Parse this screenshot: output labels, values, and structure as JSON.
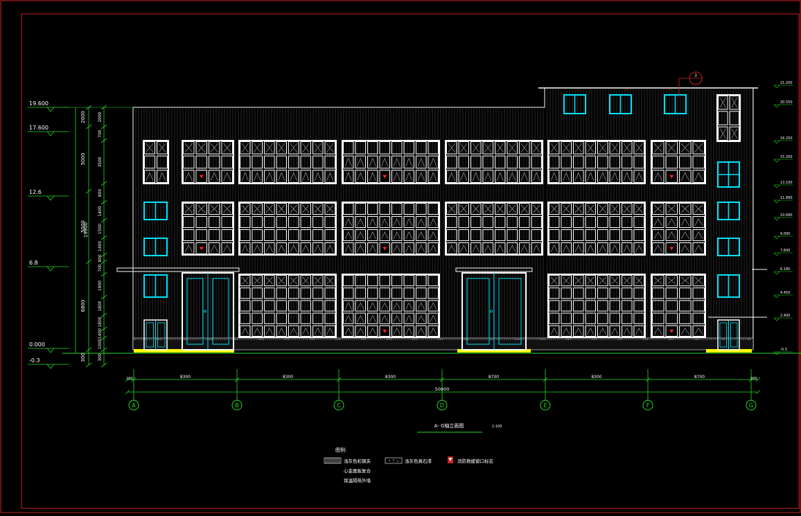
{
  "drawing": {
    "title": "A- G轴立面图",
    "scale": "1:100",
    "colors": {
      "background": "#000000",
      "frame": "#cc2222",
      "wall": "#ffffff",
      "window_white": "#ffffff",
      "window_cyan": "#00e5ff",
      "dimension": "#22dd22",
      "ground": "#ffff00",
      "marker": "#ff2222"
    },
    "left_levels": [
      "19.600",
      "17.600",
      "12.6",
      "6.8",
      "0.000",
      "-0.3"
    ],
    "right_levels": [
      "21.200",
      "20.550",
      "16.250",
      "15.200",
      "13.100",
      "11.890",
      "10.690",
      "9.000",
      "7.600",
      "6.180",
      "4.450",
      "2.400",
      "-0.3"
    ],
    "vertical_total": "19900",
    "vertical_dims_outer": [
      "2000",
      "5000",
      "5000",
      "6800",
      "300"
    ],
    "vertical_dims_inner": [
      "2000",
      "700",
      "3500",
      "800",
      "1400",
      "1500",
      "1400",
      "800",
      "700",
      "1900",
      "1800",
      "1800",
      "1400",
      "1000",
      "300"
    ],
    "axis_labels": [
      "A",
      "B",
      "C",
      "D",
      "E",
      "F",
      "G"
    ],
    "bay_dims": [
      "8300",
      "8300",
      "8300",
      "8700",
      "8300",
      "8700"
    ],
    "end_dims": [
      "100",
      "100"
    ],
    "total_dim": "50800",
    "callout": "3",
    "legend": {
      "heading": "图例:",
      "items": [
        {
          "symbol": "wall-panel",
          "text": "浅灰色彩钢夹"
        },
        {
          "symbol": "stone",
          "text": "浅灰色真石漆"
        },
        {
          "symbol": "escape-marker",
          "text": "消防救援窗口标志"
        }
      ],
      "extra_lines": [
        "心金属板复合",
        "保温隔热外墙"
      ]
    }
  }
}
